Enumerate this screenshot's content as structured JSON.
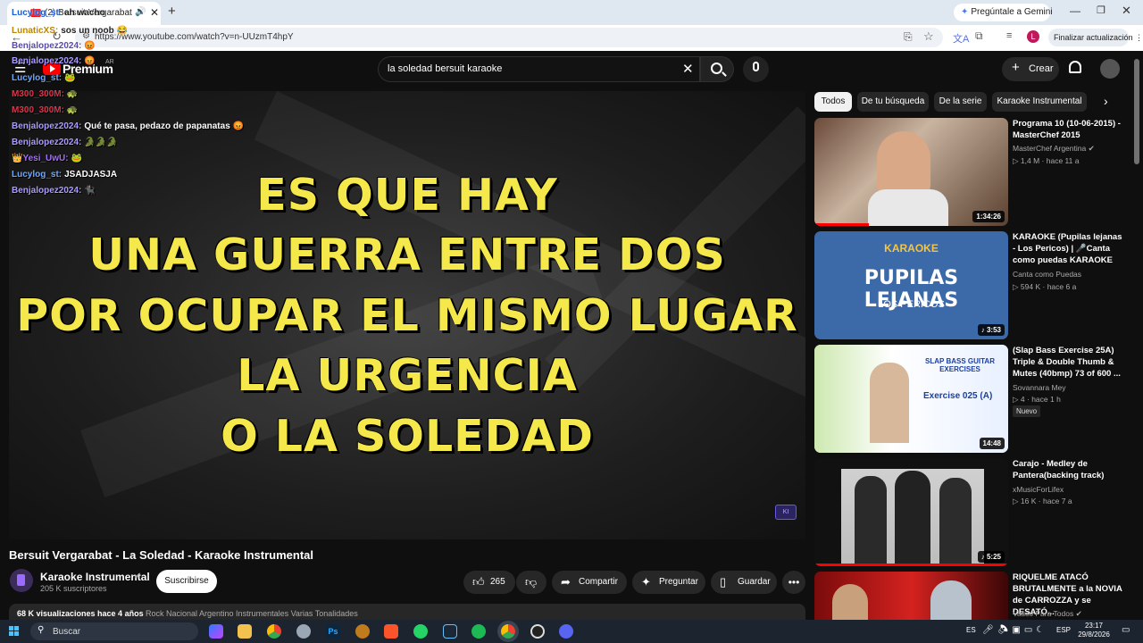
{
  "browser": {
    "tab_title": "(2) Bersuit Vergarabat - La Soled",
    "new_tab": "+",
    "url": "https://www.youtube.com/watch?v=n-UUzmT4hpY",
    "gemini_button": "Pregúntale a Gemini",
    "update_button": "Finalizar actualización",
    "profile_initial": "L"
  },
  "header": {
    "logo_text": "Premium",
    "country": "AR",
    "search_query": "la soledad bersuit karaoke",
    "create_label": "Crear"
  },
  "player": {
    "lyrics": [
      "ES QUE HAY",
      "UNA GUERRA ENTRE DOS",
      "POR OCUPAR EL MISMO LUGAR",
      "LA URGENCIA",
      "O LA SOLEDAD"
    ],
    "lyric_color": "#f5e84a"
  },
  "chat": [
    {
      "user": "Lucylog_st:",
      "message": "ah wacho",
      "user_color": "#1a5bd6",
      "dark": true
    },
    {
      "user": "LunaticXS:",
      "message": "sos un noob 😂",
      "user_color": "#b8860b",
      "dark": true
    },
    {
      "user": "Benjalopez2024:",
      "message": "😡",
      "user_color": "#5a4ab0",
      "dark": true
    },
    {
      "user": "Benjalopez2024:",
      "message": "😡",
      "user_color": "#a99cff",
      "dark": false
    },
    {
      "user": "Lucylog_st:",
      "message": "🐸",
      "user_color": "#6fa8ff",
      "dark": false
    },
    {
      "user": "M300_300M:",
      "message": "🐢",
      "user_color": "#e0334b",
      "dark": false
    },
    {
      "user": "M300_300M:",
      "message": "🐢",
      "user_color": "#e0334b",
      "dark": false
    },
    {
      "user": "Benjalopez2024:",
      "message": "Qué te pasa, pedazo de papanatas 😡",
      "user_color": "#a99cff",
      "dark": false
    },
    {
      "user": "Benjalopez2024:",
      "message": "🐊🐊🐊",
      "user_color": "#a99cff",
      "dark": false
    },
    {
      "user": "👑Yesi_UwU:",
      "message": "🐸",
      "user_color": "#a66cff",
      "dark": false
    },
    {
      "user": "Lucylog_st:",
      "message": "JSADJASJA",
      "user_color": "#6fa8ff",
      "dark": false
    },
    {
      "user": "Benjalopez2024:",
      "message": "🐈‍⬛",
      "user_color": "#a99cff",
      "dark": false
    }
  ],
  "video": {
    "title": "Bersuit Vergarabat - La Soledad - Karaoke Instrumental",
    "channel": "Karaoke Instrumental",
    "subscribers": "205 K suscriptores",
    "subscribe_label": "Suscribirse",
    "likes": "265",
    "share_label": "Compartir",
    "ask_label": "Preguntar",
    "save_label": "Guardar",
    "views_age": "68 K visualizaciones  hace 4 años",
    "tags": "Rock Nacional Argentino Instrumentales Varias Tonalidades"
  },
  "chips": [
    "Todos",
    "De tu búsqueda",
    "De la serie",
    "Karaoke Instrumental"
  ],
  "recommendations": [
    {
      "title": "Programa 10 (10-06-2015) - MasterChef 2015",
      "channel": "MasterChef Argentina",
      "views": "1,4 M",
      "age": "hace 11 a",
      "duration": "1:34:26",
      "thumb_text": "",
      "progress": 0.28
    },
    {
      "title": "KARAOKE (Pupilas lejanas - Los Pericos) | 🎤Canta como puedas KARAOKE",
      "channel": "Canta como Puedas",
      "views": "594 K",
      "age": "hace 6 a",
      "duration": "3:53",
      "thumb_text": "PUPILAS LEJANAS",
      "thumb_sub": "LOS PERICOS",
      "thumb_head": "KARAOKE",
      "progress": 0
    },
    {
      "title": "(Slap Bass Exercise 25A) Triple & Double Thumb & Mutes (40bmp) 73 of 600 ...",
      "channel": "Sovannara Mey",
      "views": "4",
      "age": "hace 1 h",
      "duration": "14:48",
      "thumb_text": "SLAP BASS GUITAR EXERCISES",
      "thumb_sub": "Exercise 025 (A)",
      "badge": "Nuevo",
      "progress": 0
    },
    {
      "title": "Carajo - Medley de Pantera(backing track)",
      "channel": "xMusicForLifex",
      "views": "16 K",
      "age": "hace 7 a",
      "duration": "5:25",
      "thumb_text": "",
      "progress": 1
    },
    {
      "title": "RIQUELME ATACÓ BRUTALMENTE a la NOVIA de CARROZZA y se DESATÓ...",
      "channel": "Vasco Para Todos",
      "views": "",
      "age": "",
      "duration": "",
      "thumb_text": "",
      "progress": 0
    }
  ],
  "taskbar": {
    "search_label": "Buscar",
    "lang": "ES",
    "layout": "ESP",
    "time": "23:17",
    "date": "29/8/2026"
  }
}
